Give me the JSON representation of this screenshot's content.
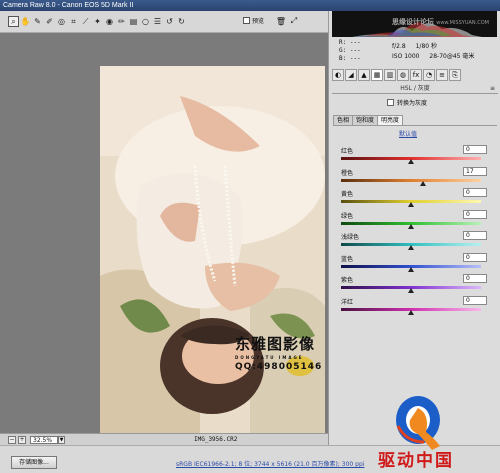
{
  "window": {
    "title": "Camera Raw 8.0 - Canon EOS 5D Mark II"
  },
  "toolbar": {
    "tools": [
      "zoom-icon",
      "hand-icon",
      "white-balance-icon",
      "color-sampler-icon",
      "target-adjust-icon",
      "crop-icon",
      "straighten-icon",
      "spot-removal-icon",
      "red-eye-icon",
      "adjustment-brush-icon",
      "graduated-filter-icon",
      "radial-filter-icon",
      "preferences-icon",
      "rotate-ccw-icon",
      "rotate-cw-icon"
    ],
    "preview_label": "预览",
    "right_icons": [
      "trash-icon",
      "fullscreen-icon"
    ]
  },
  "histogram": {
    "watermark": "思缘设计论坛",
    "watermark_url": "www.MISSYUAN.COM"
  },
  "readout": {
    "r": "R:  ---",
    "g": "G:  ---",
    "b": "B:  ---"
  },
  "exif": {
    "aperture": "f/2.8",
    "shutter": "1/80 秒",
    "iso": "ISO 1000",
    "lens": "28-70@45 毫米"
  },
  "panel": {
    "section_title": "HSL / 灰度",
    "grayscale_label": "转换为灰度",
    "subtabs": [
      "色相",
      "饱和度",
      "明亮度"
    ],
    "default_link": "默认值",
    "sliders": [
      {
        "label": "红色",
        "value": "0",
        "level": 0,
        "gradient": "linear-gradient(90deg,#5a1010,#e03030,#ffb0b0)"
      },
      {
        "label": "橙色",
        "value": "17",
        "level": 17,
        "gradient": "linear-gradient(90deg,#5a3010,#e08030,#ffd0a0)"
      },
      {
        "label": "黄色",
        "value": "0",
        "level": 0,
        "gradient": "linear-gradient(90deg,#5a5010,#e0d030,#fff8b0)"
      },
      {
        "label": "绿色",
        "value": "0",
        "level": 0,
        "gradient": "linear-gradient(90deg,#104a10,#30c030,#b8f0b8)"
      },
      {
        "label": "浅绿色",
        "value": "0",
        "level": 0,
        "gradient": "linear-gradient(90deg,#104a4a,#30c0c0,#b8f0f0)"
      },
      {
        "label": "蓝色",
        "value": "0",
        "level": 0,
        "gradient": "linear-gradient(90deg,#10104a,#3050d0,#b8c0f8)"
      },
      {
        "label": "紫色",
        "value": "0",
        "level": 0,
        "gradient": "linear-gradient(90deg,#30104a,#8030d0,#dcb8f8)"
      },
      {
        "label": "洋红",
        "value": "0",
        "level": 0,
        "gradient": "linear-gradient(90deg,#4a1040,#d030b0,#f8b8e8)"
      }
    ]
  },
  "canvas": {
    "watermark_title": "东雅图影像",
    "watermark_sub": "DONGYATU  IMAGE",
    "watermark_qq": "QQ:498005146"
  },
  "statusbar": {
    "zoom": "32.5%",
    "filename": "IMG_3956.CR2"
  },
  "bottombar": {
    "save_label": "存储图像...",
    "workflow": "sRGB IEC61966-2.1; 8 位; 3744 x 5616 (21.0 百万像素); 300 ppi"
  },
  "logo": {
    "text": "驱动中国"
  }
}
